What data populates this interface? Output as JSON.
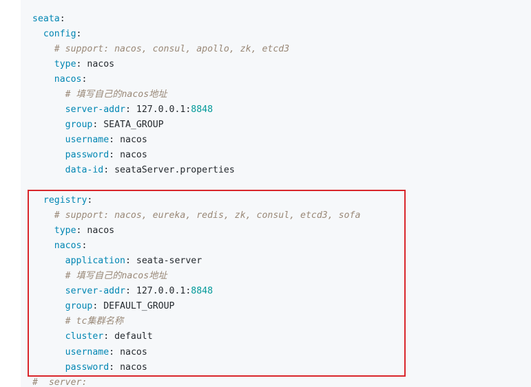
{
  "code": {
    "seata_key": "seata",
    "config_key": "config",
    "config_comment": "# support: nacos, consul, apollo, zk, etcd3",
    "config_type_key": "type",
    "config_type_val": "nacos",
    "config_nacos_key": "nacos",
    "config_nacos_comment": "# 填写自己的nacos地址",
    "config_server_addr_key": "server-addr",
    "config_server_addr_host": "127.0.0.1:",
    "config_server_addr_port": "8848",
    "config_group_key": "group",
    "config_group_val": "SEATA_GROUP",
    "config_username_key": "username",
    "config_username_val": "nacos",
    "config_password_key": "password",
    "config_password_val": "nacos",
    "config_dataid_key": "data-id",
    "config_dataid_val": "seataServer.properties",
    "registry_key": "registry",
    "registry_comment": "# support: nacos, eureka, redis, zk, consul, etcd3, sofa",
    "registry_type_key": "type",
    "registry_type_val": "nacos",
    "registry_nacos_key": "nacos",
    "registry_application_key": "application",
    "registry_application_val": "seata-server",
    "registry_nacos_comment": "# 填写自己的nacos地址",
    "registry_server_addr_key": "server-addr",
    "registry_server_addr_host": "127.0.0.1:",
    "registry_server_addr_port": "8848",
    "registry_group_key": "group",
    "registry_group_val": "DEFAULT_GROUP",
    "registry_cluster_comment": "# tc集群名称",
    "registry_cluster_key": "cluster",
    "registry_cluster_val": "default",
    "registry_username_key": "username",
    "registry_username_val": "nacos",
    "registry_password_key": "password",
    "registry_password_val": "nacos",
    "server_comment": "#  server:"
  },
  "colors": {
    "background": "#f6f8fa",
    "key": "#0086b3",
    "number": "#009999",
    "comment": "#998877",
    "highlight_border": "#d9262b"
  }
}
